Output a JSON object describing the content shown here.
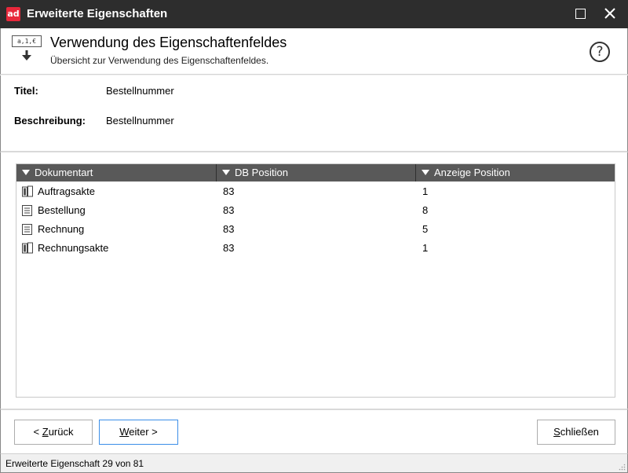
{
  "window": {
    "title": "Erweiterte Eigenschaften",
    "app_icon_text": "ad",
    "accent_color": "#e8283b"
  },
  "header": {
    "icon_tag": "a,1,€",
    "title": "Verwendung des Eigenschaftenfeldes",
    "subtitle": "Übersicht zur Verwendung des Eigenschaftenfeldes.",
    "help_symbol": "?"
  },
  "info": {
    "title_label": "Titel:",
    "title_value": "Bestellnummer",
    "description_label": "Beschreibung:",
    "description_value": "Bestellnummer"
  },
  "table": {
    "columns": [
      "Dokumentart",
      "DB Position",
      "Anzeige Position"
    ],
    "rows": [
      {
        "icon": "folder-icon",
        "document_type": "Auftragsakte",
        "db_position": "83",
        "display_position": "1"
      },
      {
        "icon": "document-icon",
        "document_type": "Bestellung",
        "db_position": "83",
        "display_position": "8"
      },
      {
        "icon": "document-icon",
        "document_type": "Rechnung",
        "db_position": "83",
        "display_position": "5"
      },
      {
        "icon": "folder-icon",
        "document_type": "Rechnungsakte",
        "db_position": "83",
        "display_position": "1"
      }
    ]
  },
  "buttons": {
    "back_prefix": "< ",
    "back_mnemonic": "Z",
    "back_rest": "urück",
    "next_mnemonic": "W",
    "next_rest": "eiter >",
    "close_mnemonic": "S",
    "close_rest": "chließen"
  },
  "status": {
    "text": "Erweiterte Eigenschaft 29 von 81"
  }
}
